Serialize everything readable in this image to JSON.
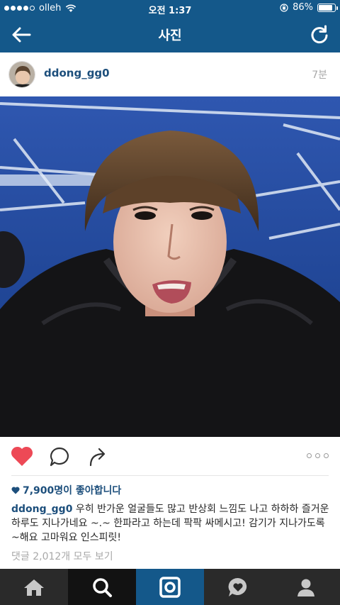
{
  "status_bar": {
    "carrier": "olleh",
    "time": "오전 1:37",
    "battery": "86%",
    "battery_level": 0.86
  },
  "header": {
    "title": "사진",
    "back_icon": "back-arrow-icon",
    "refresh_icon": "refresh-icon"
  },
  "post": {
    "username": "ddong_gg0",
    "time_ago": "7분",
    "likes": "7,900명이 좋아합니다",
    "caption_user": "ddong_gg0",
    "caption_text": " 우히 반가운 얼굴들도 많고 반상회 느낌도 나고 하하하 즐거운 하루도 지나가네요 ~.~ 한파라고 하는데 팍팍 싸메시고! 감기가 지나가도록 ~해요 고마워요 인스피릿!",
    "comments_link": "댓글 2,012개 모두 보기"
  },
  "colors": {
    "brand_blue": "#14588a",
    "username_blue": "#1d4f7c",
    "like_red": "#ed4956"
  },
  "tabbar": {
    "items": [
      "home-icon",
      "search-icon",
      "camera-icon",
      "activity-icon",
      "profile-icon"
    ]
  }
}
